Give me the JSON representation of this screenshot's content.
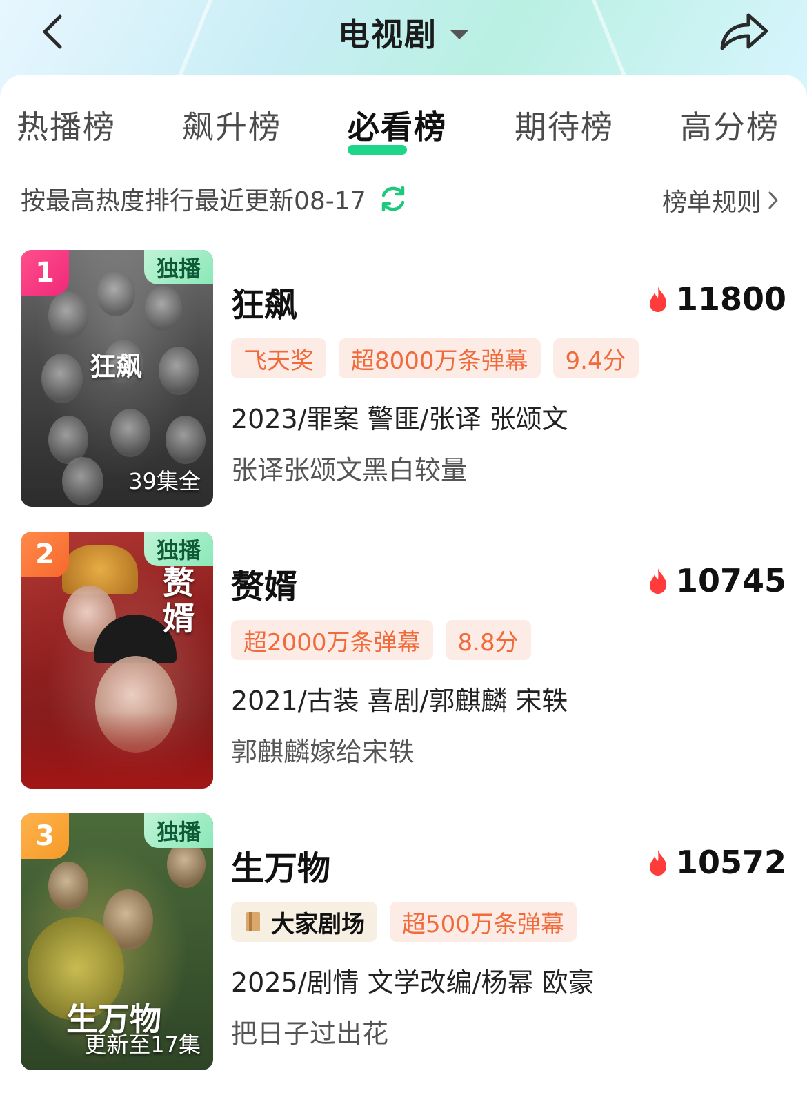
{
  "header": {
    "title": "电视剧"
  },
  "tabs": [
    {
      "label": "热播榜",
      "active": false
    },
    {
      "label": "飙升榜",
      "active": false
    },
    {
      "label": "必看榜",
      "active": true
    },
    {
      "label": "期待榜",
      "active": false
    },
    {
      "label": "高分榜",
      "active": false
    }
  ],
  "subheader": {
    "sort_text": "按最高热度排行最近更新08-17",
    "rules_label": "榜单规则"
  },
  "colors": {
    "accent_green": "#1ed68a",
    "tag_orange": "#f06a3c",
    "heat_red": "#ff3b3b"
  },
  "items": [
    {
      "rank": "1",
      "exclusive": "独播",
      "poster_title": "狂飙",
      "episode_label": "39集全",
      "title": "狂飙",
      "heat": "11800",
      "tags": [
        "飞天奖",
        "超8000万条弹幕",
        "9.4分"
      ],
      "meta": "2023/罪案 警匪/张译 张颂文",
      "desc": "张译张颂文黑白较量"
    },
    {
      "rank": "2",
      "exclusive": "独播",
      "poster_title": "赘婿",
      "title": "赘婿",
      "heat": "10745",
      "tags": [
        "超2000万条弹幕",
        "8.8分"
      ],
      "meta": "2021/古装 喜剧/郭麒麟 宋轶",
      "desc": "郭麒麟嫁给宋轶"
    },
    {
      "rank": "3",
      "exclusive": "独播",
      "poster_title": "生万物",
      "episode_label": "更新至17集",
      "title": "生万物",
      "heat": "10572",
      "theater_tag": "大家剧场",
      "tags": [
        "超500万条弹幕"
      ],
      "meta": "2025/剧情 文学改编/杨幂 欧豪",
      "desc": "把日子过出花"
    }
  ]
}
